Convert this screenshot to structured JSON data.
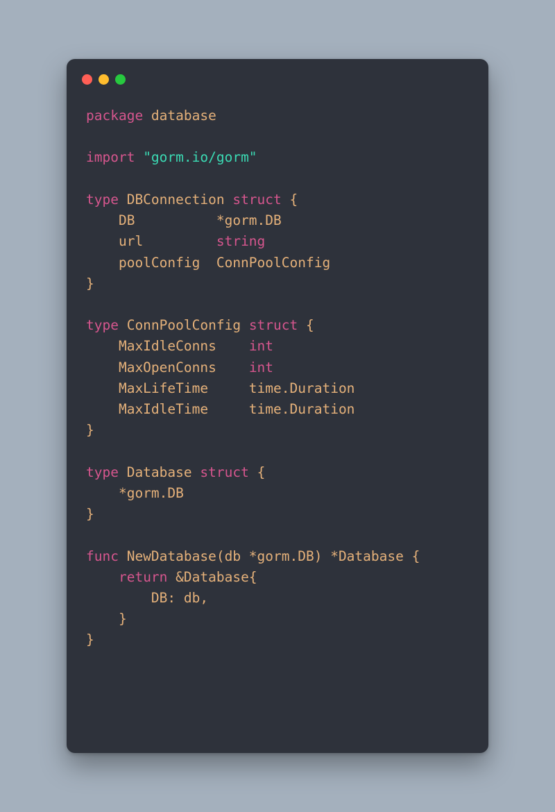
{
  "code": {
    "tokens": [
      [
        [
          "kw",
          "package "
        ],
        [
          "pl",
          "database"
        ]
      ],
      [],
      [
        [
          "kw",
          "import "
        ],
        [
          "st",
          "\"gorm.io/gorm\""
        ]
      ],
      [],
      [
        [
          "kw",
          "type "
        ],
        [
          "pl",
          "DBConnection "
        ],
        [
          "kw",
          "struct "
        ],
        [
          "pl",
          "{"
        ]
      ],
      [
        [
          "pl",
          "    DB          *gorm.DB"
        ]
      ],
      [
        [
          "pl",
          "    url         "
        ],
        [
          "kw",
          "string"
        ]
      ],
      [
        [
          "pl",
          "    poolConfig  ConnPoolConfig"
        ]
      ],
      [
        [
          "pl",
          "}"
        ]
      ],
      [],
      [
        [
          "kw",
          "type "
        ],
        [
          "pl",
          "ConnPoolConfig "
        ],
        [
          "kw",
          "struct "
        ],
        [
          "pl",
          "{"
        ]
      ],
      [
        [
          "pl",
          "    MaxIdleConns    "
        ],
        [
          "kw",
          "int"
        ]
      ],
      [
        [
          "pl",
          "    MaxOpenConns    "
        ],
        [
          "kw",
          "int"
        ]
      ],
      [
        [
          "pl",
          "    MaxLifeTime     time.Duration"
        ]
      ],
      [
        [
          "pl",
          "    MaxIdleTime     time.Duration"
        ]
      ],
      [
        [
          "pl",
          "}"
        ]
      ],
      [],
      [
        [
          "kw",
          "type "
        ],
        [
          "pl",
          "Database "
        ],
        [
          "kw",
          "struct "
        ],
        [
          "pl",
          "{"
        ]
      ],
      [
        [
          "pl",
          "    *gorm.DB"
        ]
      ],
      [
        [
          "pl",
          "}"
        ]
      ],
      [],
      [
        [
          "kw",
          "func "
        ],
        [
          "pl",
          "NewDatabase(db *gorm.DB) *Database {"
        ]
      ],
      [
        [
          "pl",
          "    "
        ],
        [
          "kw",
          "return "
        ],
        [
          "pl",
          "&Database{"
        ]
      ],
      [
        [
          "pl",
          "        DB: db,"
        ]
      ],
      [
        [
          "pl",
          "    }"
        ]
      ],
      [
        [
          "pl",
          "}"
        ]
      ]
    ]
  }
}
